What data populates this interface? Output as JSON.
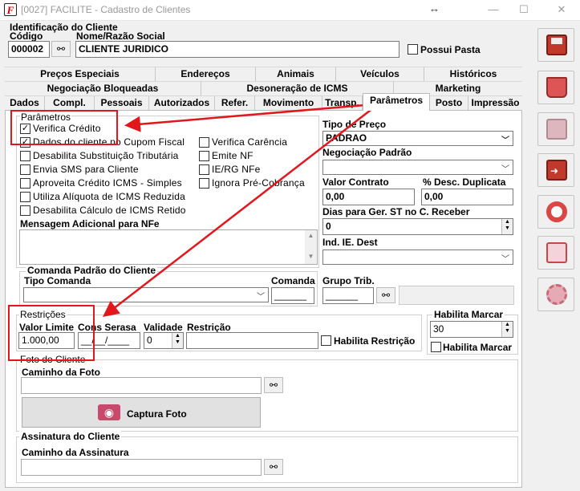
{
  "window": {
    "title": "[0027] FACILITE - Cadastro de Clientes",
    "logo_letter": "F"
  },
  "ident": {
    "group_title": "Identificação do Cliente",
    "codigo_label": "Código",
    "codigo_value": "000002",
    "nome_label": "Nome/Razão Social",
    "nome_value": "CLIENTE JURIDICO",
    "possui_pasta": "Possui Pasta"
  },
  "tabs_row1": [
    "Preços Especiais",
    "Endereços",
    "Animais",
    "Veículos",
    "Históricos"
  ],
  "tabs_row2": [
    "Negociação Bloqueadas",
    "Desoneração de ICMS",
    "Marketing"
  ],
  "tabs_row3": [
    "Dados",
    "Compl.",
    "Pessoais",
    "Autorizados",
    "Refer.",
    "Movimento",
    "Transp.",
    "Parâmetros",
    "Posto",
    "Impressão"
  ],
  "parametros": {
    "title": "Parâmetros",
    "checks_left": [
      {
        "label": "Verifica Crédito",
        "checked": "✓"
      },
      {
        "label": "Dados do cliente no Cupom Fiscal",
        "checked": "✓"
      },
      {
        "label": "Desabilita Substituição Tributária",
        "checked": ""
      },
      {
        "label": "Envia SMS para Cliente",
        "checked": ""
      },
      {
        "label": "Aproveita Crédito ICMS - Simples",
        "checked": ""
      },
      {
        "label": "Utiliza Alíquota de ICMS Reduzida",
        "checked": ""
      },
      {
        "label": "Desabilita Cálculo de ICMS Retido",
        "checked": ""
      }
    ],
    "checks_right": [
      {
        "label": "Verifica Carência",
        "checked": ""
      },
      {
        "label": "Emite NF",
        "checked": ""
      },
      {
        "label": "IE/RG NFe",
        "checked": ""
      },
      {
        "label": "Ignora Pré-Cobrança",
        "checked": ""
      }
    ],
    "msg_label": "Mensagem Adicional para NFe"
  },
  "right": {
    "tipo_preco_label": "Tipo de Preço",
    "tipo_preco_value": "PADRAO",
    "negociacao_label": "Negociação Padrão",
    "valor_contrato_label": "Valor Contrato",
    "valor_contrato_value": "0,00",
    "desc_dup_label": "% Desc. Duplicata",
    "desc_dup_value": "0,00",
    "dias_label": "Dias para Ger. ST no C. Receber",
    "dias_value": "0",
    "ind_ie_label": "Ind. IE. Dest",
    "grupo_trib_label": "Grupo Trib.",
    "grupo_trib_value": "______"
  },
  "comanda": {
    "title": "Comanda Padrão do Cliente",
    "tipo_label": "Tipo Comanda",
    "comanda_label": "Comanda",
    "comanda_value": "______"
  },
  "restricoes": {
    "title": "Restrições",
    "valor_limite_label": "Valor Limite",
    "valor_limite_value": "1.000,00",
    "cons_serasa_label": "Cons Serasa",
    "cons_serasa_value": "__/__/____",
    "validade_label": "Validade",
    "validade_value": "0",
    "restricao_label": "Restrição",
    "habilita_restricao": "Habilita Restrição"
  },
  "marcar": {
    "title": "Habilita Marcar",
    "value": "30",
    "checkbox": "Habilita Marcar"
  },
  "foto": {
    "title": "Foto do Cliente",
    "caminho_label": "Caminho da Foto",
    "captura_button": "Captura Foto"
  },
  "assinatura": {
    "title": "Assinatura do Cliente",
    "caminho_label": "Caminho da Assinatura"
  },
  "sidebar": [
    "save-icon",
    "trash-icon",
    "printer-icon",
    "exit-door-icon",
    "lifebuoy-icon",
    "card-icon",
    "settings-icon"
  ]
}
